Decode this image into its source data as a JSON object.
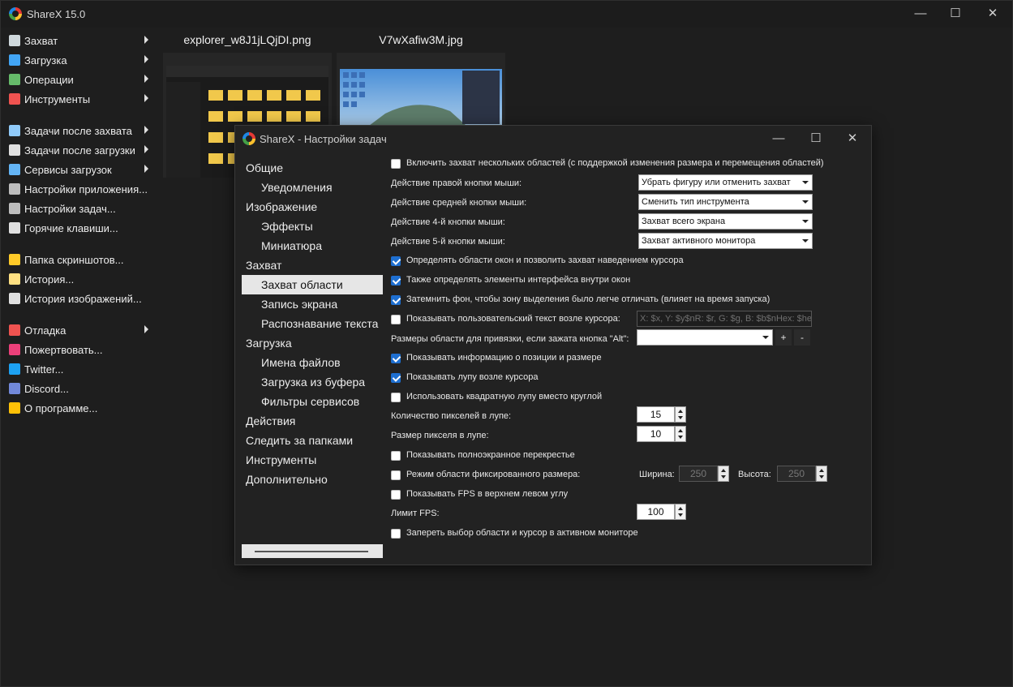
{
  "app": {
    "title": "ShareX 15.0"
  },
  "menu": [
    {
      "label": "Захват",
      "arrow": true,
      "icon": "capture-icon",
      "color": "#cfd8dc"
    },
    {
      "label": "Загрузка",
      "arrow": true,
      "icon": "upload-icon",
      "color": "#42a5f5"
    },
    {
      "label": "Операции",
      "arrow": true,
      "icon": "workflows-icon",
      "color": "#66bb6a"
    },
    {
      "label": "Инструменты",
      "arrow": true,
      "icon": "tools-icon",
      "color": "#ef5350"
    },
    {
      "sep": true
    },
    {
      "label": "Задачи после захвата",
      "arrow": true,
      "icon": "after-capture-icon",
      "color": "#90caf9"
    },
    {
      "label": "Задачи после загрузки",
      "arrow": true,
      "icon": "after-upload-icon",
      "color": "#e0e0e0"
    },
    {
      "label": "Сервисы загрузок",
      "arrow": true,
      "icon": "destinations-icon",
      "color": "#64b5f6"
    },
    {
      "label": "Настройки приложения...",
      "arrow": false,
      "icon": "app-settings-icon",
      "color": "#bdbdbd"
    },
    {
      "label": "Настройки задач...",
      "arrow": false,
      "icon": "task-settings-icon",
      "color": "#bdbdbd"
    },
    {
      "label": "Горячие клавиши...",
      "arrow": false,
      "icon": "hotkeys-icon",
      "color": "#e0e0e0"
    },
    {
      "sep": true
    },
    {
      "label": "Папка скриншотов...",
      "arrow": false,
      "icon": "folder-icon",
      "color": "#ffca28"
    },
    {
      "label": "История...",
      "arrow": false,
      "icon": "history-icon",
      "color": "#ffe082"
    },
    {
      "label": "История изображений...",
      "arrow": false,
      "icon": "image-history-icon",
      "color": "#e0e0e0"
    },
    {
      "sep": true
    },
    {
      "label": "Отладка",
      "arrow": true,
      "icon": "debug-icon",
      "color": "#ef5350"
    },
    {
      "label": "Пожертвовать...",
      "arrow": false,
      "icon": "heart-icon",
      "color": "#ec407a"
    },
    {
      "label": "Twitter...",
      "arrow": false,
      "icon": "twitter-icon",
      "color": "#1da1f2"
    },
    {
      "label": "Discord...",
      "arrow": false,
      "icon": "discord-icon",
      "color": "#7289da"
    },
    {
      "label": "О программе...",
      "arrow": false,
      "icon": "crown-icon",
      "color": "#ffc107"
    }
  ],
  "thumbnails": [
    {
      "title": "explorer_w8J1jLQjDI.png"
    },
    {
      "title": "V7wXafiw3M.jpg"
    }
  ],
  "dialog": {
    "title": "ShareX - Настройки задач",
    "tree": [
      {
        "label": "Общие",
        "level": 0
      },
      {
        "label": "Уведомления",
        "level": 1
      },
      {
        "label": "Изображение",
        "level": 0
      },
      {
        "label": "Эффекты",
        "level": 1
      },
      {
        "label": "Миниатюра",
        "level": 1
      },
      {
        "label": "Захват",
        "level": 0
      },
      {
        "label": "Захват области",
        "level": 1,
        "selected": true
      },
      {
        "label": "Запись экрана",
        "level": 1
      },
      {
        "label": "Распознавание текста",
        "level": 1
      },
      {
        "label": "Загрузка",
        "level": 0
      },
      {
        "label": "Имена файлов",
        "level": 1
      },
      {
        "label": "Загрузка из буфера",
        "level": 1
      },
      {
        "label": "Фильтры сервисов",
        "level": 1
      },
      {
        "label": "Действия",
        "level": 0
      },
      {
        "label": "Следить за папками",
        "level": 0
      },
      {
        "label": "Инструменты",
        "level": 0
      },
      {
        "label": "Дополнительно",
        "level": 0
      }
    ],
    "settings": {
      "multi_region": {
        "label": "Включить захват нескольких областей (с поддержкой изменения размера и перемещения областей)",
        "checked": false
      },
      "right_click": {
        "label": "Действие правой кнопки мыши:",
        "value": "Убрать фигуру или отменить захват"
      },
      "middle_click": {
        "label": "Действие средней кнопки мыши:",
        "value": "Сменить тип инструмента"
      },
      "mouse4": {
        "label": "Действие 4-й кнопки мыши:",
        "value": "Захват всего экрана"
      },
      "mouse5": {
        "label": "Действие 5-й кнопки мыши:",
        "value": "Захват активного монитора"
      },
      "detect_windows": {
        "label": "Определять области окон и позволить захват наведением курсора",
        "checked": true
      },
      "detect_controls": {
        "label": "Также определять элементы интерфейса внутри окон",
        "checked": true
      },
      "dim_background": {
        "label": "Затемнить фон, чтобы зону выделения было легче отличать (влияет на время запуска)",
        "checked": true
      },
      "custom_info": {
        "label": "Показывать пользовательский текст возле курсора:",
        "checked": false,
        "placeholder": "X: $x, Y: $y$nR: $r, G: $g, B: $b$nHex: $hex"
      },
      "snap_sizes": {
        "label": "Размеры области для привязки, если зажата кнопка \"Alt\":",
        "value": "",
        "add": "+",
        "remove": "-"
      },
      "show_info": {
        "label": "Показывать информацию о позиции и размере",
        "checked": true
      },
      "show_magnifier": {
        "label": "Показывать лупу возле курсора",
        "checked": true
      },
      "square_magnifier": {
        "label": "Использовать квадратную лупу вместо круглой",
        "checked": false
      },
      "magnifier_pixels": {
        "label": "Количество пикселей в лупе:",
        "value": "15"
      },
      "magnifier_size": {
        "label": "Размер пикселя в лупе:",
        "value": "10"
      },
      "crosshair": {
        "label": "Показывать полноэкранное перекрестье",
        "checked": false
      },
      "fixed_size": {
        "label": "Режим области фиксированного размера:",
        "checked": false,
        "width_label": "Ширина:",
        "width": "250",
        "height_label": "Высота:",
        "height": "250"
      },
      "show_fps": {
        "label": "Показывать FPS в верхнем левом углу",
        "checked": false
      },
      "fps_limit": {
        "label": "Лимит FPS:",
        "value": "100"
      },
      "lock_monitor": {
        "label": "Запереть выбор области и курсор в активном мониторе",
        "checked": false
      }
    }
  }
}
